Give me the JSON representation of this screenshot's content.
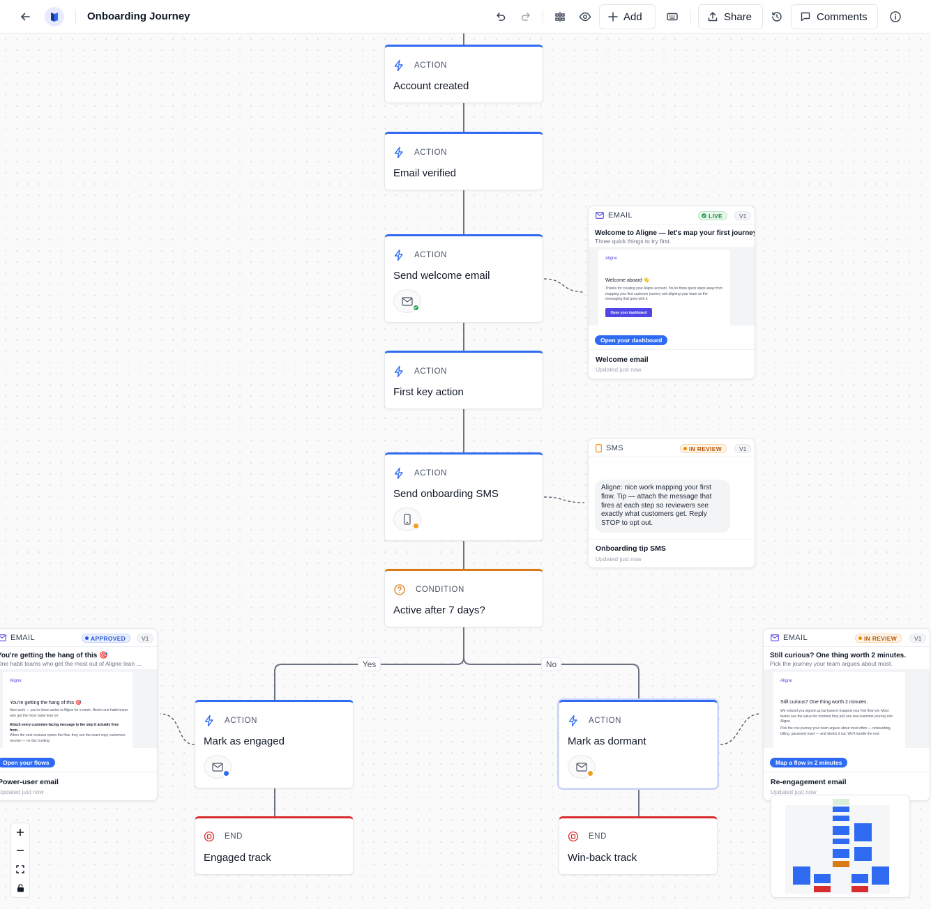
{
  "toolbar": {
    "title": "Onboarding Journey",
    "add_label": "Add",
    "share_label": "Share",
    "comments_label": "Comments",
    "icons": [
      "back-arrow-icon",
      "app-logo-icon",
      "undo-icon",
      "redo-icon",
      "layout-icon",
      "eye-icon",
      "plus-icon",
      "keyboard-icon",
      "upload-icon",
      "history-icon",
      "comment-icon",
      "info-icon"
    ]
  },
  "nodes": [
    {
      "kind": "ACTION",
      "title": "Account created"
    },
    {
      "kind": "ACTION",
      "title": "Email verified"
    },
    {
      "kind": "ACTION",
      "title": "Send welcome email",
      "channel": "email",
      "status_color": "#22a04b"
    },
    {
      "kind": "ACTION",
      "title": "First key action"
    },
    {
      "kind": "ACTION",
      "title": "Send onboarding SMS",
      "channel": "sms",
      "status_color": "#f0a020"
    },
    {
      "kind": "CONDITION",
      "title": "Active after 7 days?"
    },
    {
      "kind": "ACTION",
      "title": "Mark as engaged",
      "channel": "email",
      "status_color": "#2f6bf2"
    },
    {
      "kind": "ACTION",
      "title": "Mark as dormant",
      "channel": "email",
      "status_color": "#f0a020"
    },
    {
      "kind": "END",
      "title": "Engaged track"
    },
    {
      "kind": "END",
      "title": "Win-back track"
    }
  ],
  "edges": {
    "yes": "Yes",
    "no": "No"
  },
  "cards": {
    "welcome": {
      "kind": "EMAIL",
      "status": "LIVE",
      "version": "V1",
      "subject": "Welcome to Aligne — let's map your first journey",
      "preheader": "Three quick things to try first.",
      "brand": "Aligne",
      "hello": "Welcome aboard 👋",
      "body": "Thanks for creating your Aligne account. You're three quick steps away from mapping your first customer journey and aligning your team on the messaging that goes with it.",
      "mini_button": "Open your dashboard",
      "cta": "Open your dashboard",
      "name": "Welcome email",
      "updated": "Updated just now"
    },
    "sms": {
      "kind": "SMS",
      "status": "IN REVIEW",
      "version": "V1",
      "message": "Aligne: nice work mapping your first flow. Tip — attach the message that fires at each step so reviewers see exactly what customers get. Reply STOP to opt out.",
      "name": "Onboarding tip SMS",
      "updated": "Updated just now"
    },
    "power": {
      "kind": "EMAIL",
      "status": "APPROVED",
      "version": "V1",
      "subject": "You're getting the hang of this 🎯",
      "preheader": "One habit teams who get the most out of Aligne lean ...",
      "brand": "Aligne",
      "hello": "You're getting the hang of this 🎯",
      "body": "Nice work — you've been active in Aligne for a week. Here's one habit teams who get the most value lean on:",
      "body_bold": "Attach every customer-facing message to the step it actually fires from.",
      "body_rest": "When the next reviewer opens the flow, they see the exact copy customers receive — no doc hunting.",
      "cta": "Open your flows",
      "name": "Power-user email",
      "updated": "Updated just now"
    },
    "reengage": {
      "kind": "EMAIL",
      "status": "IN REVIEW",
      "version": "V1",
      "subject": "Still curious? One thing worth 2 minutes.",
      "preheader": "Pick the journey your team argues about most.",
      "brand": "Aligne",
      "hello": "Still curious? One thing worth 2 minutes.",
      "body": "We noticed you signed up but haven't mapped your first flow yet. Most teams see the value the moment they pull one real customer journey into Aligne.",
      "body2": "Pick the one journey your team argues about most often — onboarding, billing, password reset — and sketch it out. We'll handle the rest.",
      "cta": "Map a flow in 2 minutes",
      "name": "Re-engagement email",
      "updated": "Updated just now"
    }
  },
  "zoom_controls": [
    "plus-icon",
    "minus-icon",
    "fit-view-icon",
    "lock-icon"
  ],
  "colors": {
    "action": "#2f6bf2",
    "condition": "#d97a16",
    "end": "#d92d2d",
    "selected_ring": "#c7d2fe"
  }
}
